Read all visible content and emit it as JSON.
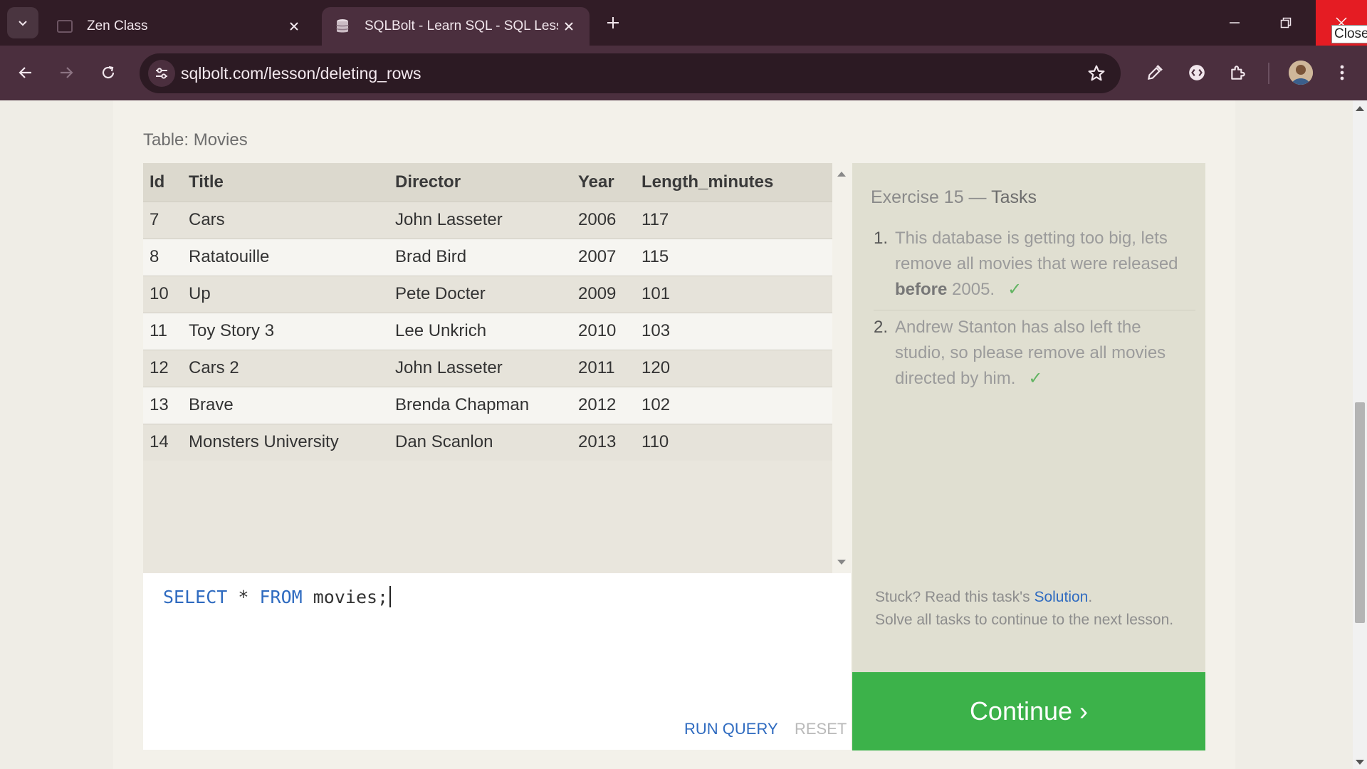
{
  "browser": {
    "tabs": [
      {
        "title": "Zen Class",
        "active": false
      },
      {
        "title": "SQLBolt - Learn SQL - SQL Lesson",
        "active": true
      }
    ],
    "url": "sqlbolt.com/lesson/deleting_rows",
    "close_tooltip": "Close"
  },
  "page": {
    "table_caption": "Table: Movies",
    "columns": [
      "Id",
      "Title",
      "Director",
      "Year",
      "Length_minutes"
    ],
    "rows": [
      [
        "7",
        "Cars",
        "John Lasseter",
        "2006",
        "117"
      ],
      [
        "8",
        "Ratatouille",
        "Brad Bird",
        "2007",
        "115"
      ],
      [
        "10",
        "Up",
        "Pete Docter",
        "2009",
        "101"
      ],
      [
        "11",
        "Toy Story 3",
        "Lee Unkrich",
        "2010",
        "103"
      ],
      [
        "12",
        "Cars 2",
        "John Lasseter",
        "2011",
        "120"
      ],
      [
        "13",
        "Brave",
        "Brenda Chapman",
        "2012",
        "102"
      ],
      [
        "14",
        "Monsters University",
        "Dan Scanlon",
        "2013",
        "110"
      ]
    ],
    "editor": {
      "kw_select": "SELECT",
      "star": " * ",
      "kw_from": "FROM",
      "rest": " movies;"
    },
    "run_query_label": "RUN QUERY",
    "reset_label": "RESET",
    "tasks": {
      "title_prefix": "Exercise 15 — ",
      "title_suffix": "Tasks",
      "items": [
        {
          "num": "1.",
          "text_before": "This database is getting too big, lets remove all movies that were released ",
          "bold": "before",
          "text_after": " 2005.",
          "check": "✓"
        },
        {
          "num": "2.",
          "text": "Andrew Stanton has also left the studio, so please remove all movies directed by him.",
          "check": "✓"
        }
      ],
      "stuck_prefix": "Stuck? Read this task's ",
      "solution_link": "Solution",
      "stuck_suffix": ".",
      "solve_note": "Solve all tasks to continue to the next lesson.",
      "continue_label": "Continue ›"
    }
  },
  "colors": {
    "titlebar": "#311c26",
    "toolbar": "#4b2f3e",
    "link_blue": "#2f6bc0",
    "continue_green": "#3cb24a",
    "check_green": "#62b462"
  }
}
